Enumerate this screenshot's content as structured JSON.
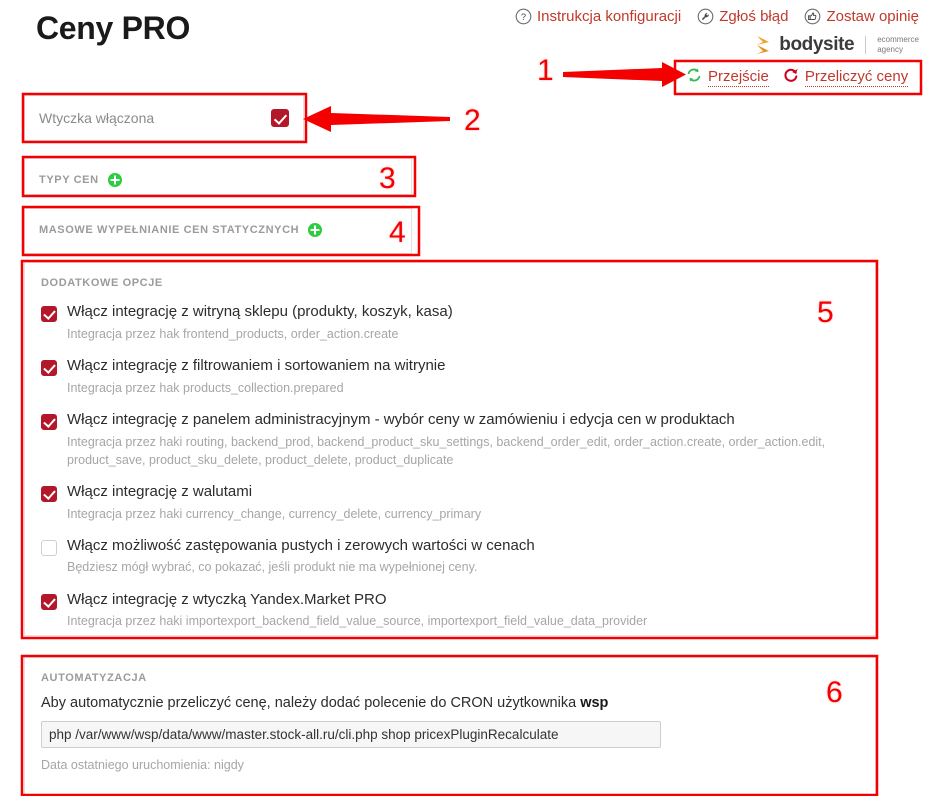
{
  "header": {
    "title": "Ceny PRO",
    "help_links": [
      {
        "icon": "question-circle-icon",
        "label": "Instrukcja konfiguracji"
      },
      {
        "icon": "wrench-circle-icon",
        "label": "Zgłoś błąd"
      },
      {
        "icon": "thumbs-up-circle-icon",
        "label": "Zostaw opinię"
      }
    ],
    "brand": {
      "name": "bodysite",
      "tagline_line1": "ecommerce",
      "tagline_line2": "agency",
      "mark_color": "#f0a030"
    },
    "actions": [
      {
        "icon": "sync-refresh-icon",
        "label": "Przejście",
        "color": "#2ebd4e"
      },
      {
        "icon": "recalculate-arrow-icon",
        "label": "Przeliczyć ceny",
        "color": "#d0021b"
      }
    ]
  },
  "plugin_enabled": {
    "label": "Wtyczka włączona",
    "checked": true
  },
  "sections": {
    "price_types": {
      "label": "Typy cen",
      "add_icon": "plus-circle-icon"
    },
    "bulk_fill": {
      "label": "Masowe wypełnianie cen statycznych",
      "add_icon": "plus-circle-icon"
    }
  },
  "options": {
    "label": "Dodatkowe opcje",
    "items": [
      {
        "checked": true,
        "title": "Włącz integrację z witryną sklepu (produkty, koszyk, kasa)",
        "desc": "Integracja przez hak frontend_products, order_action.create"
      },
      {
        "checked": true,
        "title": "Włącz integrację z filtrowaniem i sortowaniem na witrynie",
        "desc": "Integracja przez hak products_collection.prepared"
      },
      {
        "checked": true,
        "title": "Włącz integrację z panelem administracyjnym - wybór ceny w zamówieniu i edycja cen w produktach",
        "desc": "Integracja przez haki routing, backend_prod, backend_product_sku_settings, backend_order_edit, order_action.create, order_action.edit, product_save, product_sku_delete, product_delete, product_duplicate"
      },
      {
        "checked": true,
        "title": "Włącz integrację z walutami",
        "desc": "Integracja przez haki currency_change, currency_delete, currency_primary"
      },
      {
        "checked": false,
        "title": "Włącz możliwość zastępowania pustych i zerowych wartości w cenach",
        "desc": "Będziesz mógł wybrać, co pokazać, jeśli produkt nie ma wypełnionej ceny."
      },
      {
        "checked": true,
        "title": "Włącz integrację z wtyczką Yandex.Market PRO",
        "desc": "Integracja przez haki importexport_backend_field_value_source, importexport_field_value_data_provider"
      }
    ]
  },
  "automation": {
    "label": "Automatyzacja",
    "intro_prefix": "Aby automatycznie przeliczyć cenę, należy dodać polecenie do CRON użytkownika ",
    "intro_user": "wsp",
    "cron_command": "php /var/www/wsp/data/www/master.stock-all.ru/cli.php shop pricexPluginRecalculate",
    "last_run": "Data ostatniego uruchomienia: nigdy"
  },
  "annotations": {
    "color": "#f40000",
    "markers": [
      {
        "number": "1"
      },
      {
        "number": "2"
      },
      {
        "number": "3"
      },
      {
        "number": "4"
      },
      {
        "number": "5"
      },
      {
        "number": "6"
      }
    ]
  }
}
